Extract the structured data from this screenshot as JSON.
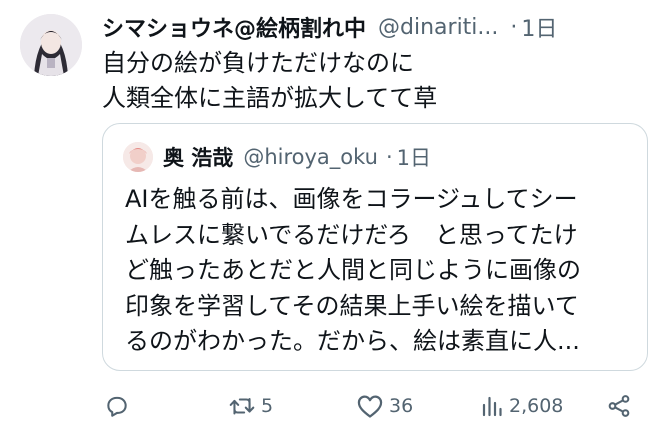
{
  "author": {
    "display_name": "シマショウネ@絵柄割れ中",
    "handle": "@dinariti...",
    "separator": "·",
    "time": "1日"
  },
  "tweet": {
    "lines": [
      "自分の絵が負けただけなのに",
      "人類全体に主語が拡大してて草"
    ]
  },
  "quote": {
    "display_name": "奥 浩哉",
    "handle": "@hiroya_oku",
    "separator": "·",
    "time": "1日",
    "lines": [
      "AIを触る前は、画像をコラージュしてシー",
      "ムレスに繋いでるだけだろ　と思ってたけ",
      "ど触ったあとだと人間と同じように画像の",
      "印象を学習してその結果上手い絵を描いて",
      "るのがわかった。だから、絵は素直に人..."
    ]
  },
  "actions": {
    "reply": {
      "icon": "reply-icon",
      "count": ""
    },
    "retweet": {
      "icon": "retweet-icon",
      "count": "5"
    },
    "like": {
      "icon": "heart-icon",
      "count": "36"
    },
    "views": {
      "icon": "views-icon",
      "count": "2,608"
    },
    "share": {
      "icon": "share-icon"
    }
  },
  "colors": {
    "text": "#0f1419",
    "secondary": "#536471",
    "border": "#cfd9de"
  }
}
